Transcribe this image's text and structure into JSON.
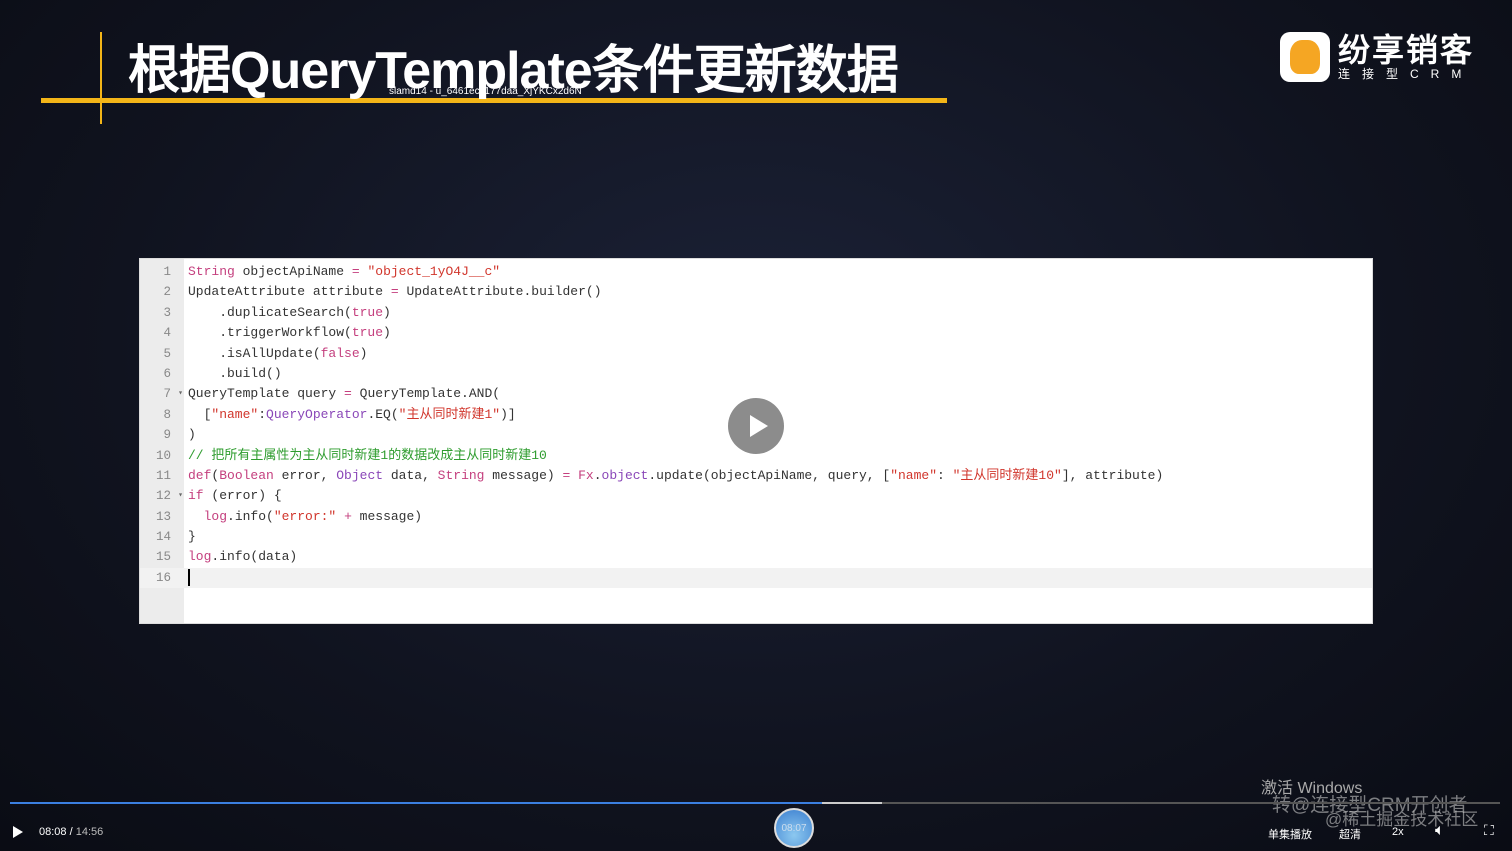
{
  "slide": {
    "title": "根据QueryTemplate条件更新数据",
    "watermark": "slamd14 - u_6461ec1177daa_XjYKCx2d6N",
    "accent": "#f3b518"
  },
  "logo": {
    "name": "纷享销客",
    "tagline": "连接型CRM"
  },
  "editor": {
    "lines": [
      [
        [
          "kw",
          "String"
        ],
        [
          "pl",
          " objectApiName "
        ],
        [
          "kw",
          "="
        ],
        [
          "pl",
          " "
        ],
        [
          "str",
          "\"object_1yO4J__c\""
        ]
      ],
      [
        [
          "pl",
          "UpdateAttribute attribute "
        ],
        [
          "kw",
          "="
        ],
        [
          "pl",
          " UpdateAttribute.builder()"
        ]
      ],
      [
        [
          "pl",
          "    .duplicateSearch("
        ],
        [
          "kw",
          "true"
        ],
        [
          "pl",
          ")"
        ]
      ],
      [
        [
          "pl",
          "    .triggerWorkflow("
        ],
        [
          "kw",
          "true"
        ],
        [
          "pl",
          ")"
        ]
      ],
      [
        [
          "pl",
          "    .isAllUpdate("
        ],
        [
          "kw",
          "false"
        ],
        [
          "pl",
          ")"
        ]
      ],
      [
        [
          "pl",
          "    .build()"
        ]
      ],
      [
        [
          "pl",
          "QueryTemplate query "
        ],
        [
          "kw",
          "="
        ],
        [
          "pl",
          " QueryTemplate.AND("
        ]
      ],
      [
        [
          "pl",
          "  ["
        ],
        [
          "str",
          "\"name\""
        ],
        [
          "pl",
          ":"
        ],
        [
          "ty",
          "QueryOperator"
        ],
        [
          "pl",
          ".EQ("
        ],
        [
          "str",
          "\"主从同时新建1\""
        ],
        [
          "pl",
          ")]"
        ]
      ],
      [
        [
          "pl",
          ")"
        ]
      ],
      [
        [
          "cm",
          "// 把所有主属性为主从同时新建1的数据改成主从同时新建10"
        ]
      ],
      [
        [
          "kw",
          "def"
        ],
        [
          "pl",
          "("
        ],
        [
          "kw",
          "Boolean"
        ],
        [
          "pl",
          " error, "
        ],
        [
          "ty",
          "Object"
        ],
        [
          "pl",
          " data, "
        ],
        [
          "kw",
          "String"
        ],
        [
          "pl",
          " message) "
        ],
        [
          "kw",
          "="
        ],
        [
          "pl",
          " "
        ],
        [
          "kw",
          "Fx"
        ],
        [
          "pl",
          "."
        ],
        [
          "ty",
          "object"
        ],
        [
          "pl",
          ".update(objectApiName, query, ["
        ],
        [
          "str",
          "\"name\""
        ],
        [
          "pl",
          ": "
        ],
        [
          "str",
          "\"主从同时新建10\""
        ],
        [
          "pl",
          "], attribute)"
        ]
      ],
      [
        [
          "kw",
          "if"
        ],
        [
          "pl",
          " (error) {"
        ]
      ],
      [
        [
          "pl",
          "  "
        ],
        [
          "kw",
          "log"
        ],
        [
          "pl",
          ".info("
        ],
        [
          "str",
          "\"error:\""
        ],
        [
          "pl",
          " "
        ],
        [
          "kw",
          "+"
        ],
        [
          "pl",
          " message)"
        ]
      ],
      [
        [
          "pl",
          "}"
        ]
      ],
      [
        [
          "kw",
          "log"
        ],
        [
          "pl",
          ".info(data)"
        ]
      ],
      []
    ],
    "fold_lines": [
      7,
      12
    ],
    "active_line": 16
  },
  "overlay": {
    "activation": "激活 Windows",
    "watermark1": "转@连接型CRM开创者",
    "watermark2": "@稀土掘金技术社区"
  },
  "player": {
    "current": "08:08",
    "total": "14:56",
    "hover_time": "08:07",
    "progress_percent": 54.5,
    "buffer_percent": 58.5,
    "playlist_label": "单集播放",
    "quality_label": "超清",
    "speed_label": "2x",
    "icons": [
      "play-icon",
      "volume-icon",
      "fullscreen-icon"
    ]
  }
}
